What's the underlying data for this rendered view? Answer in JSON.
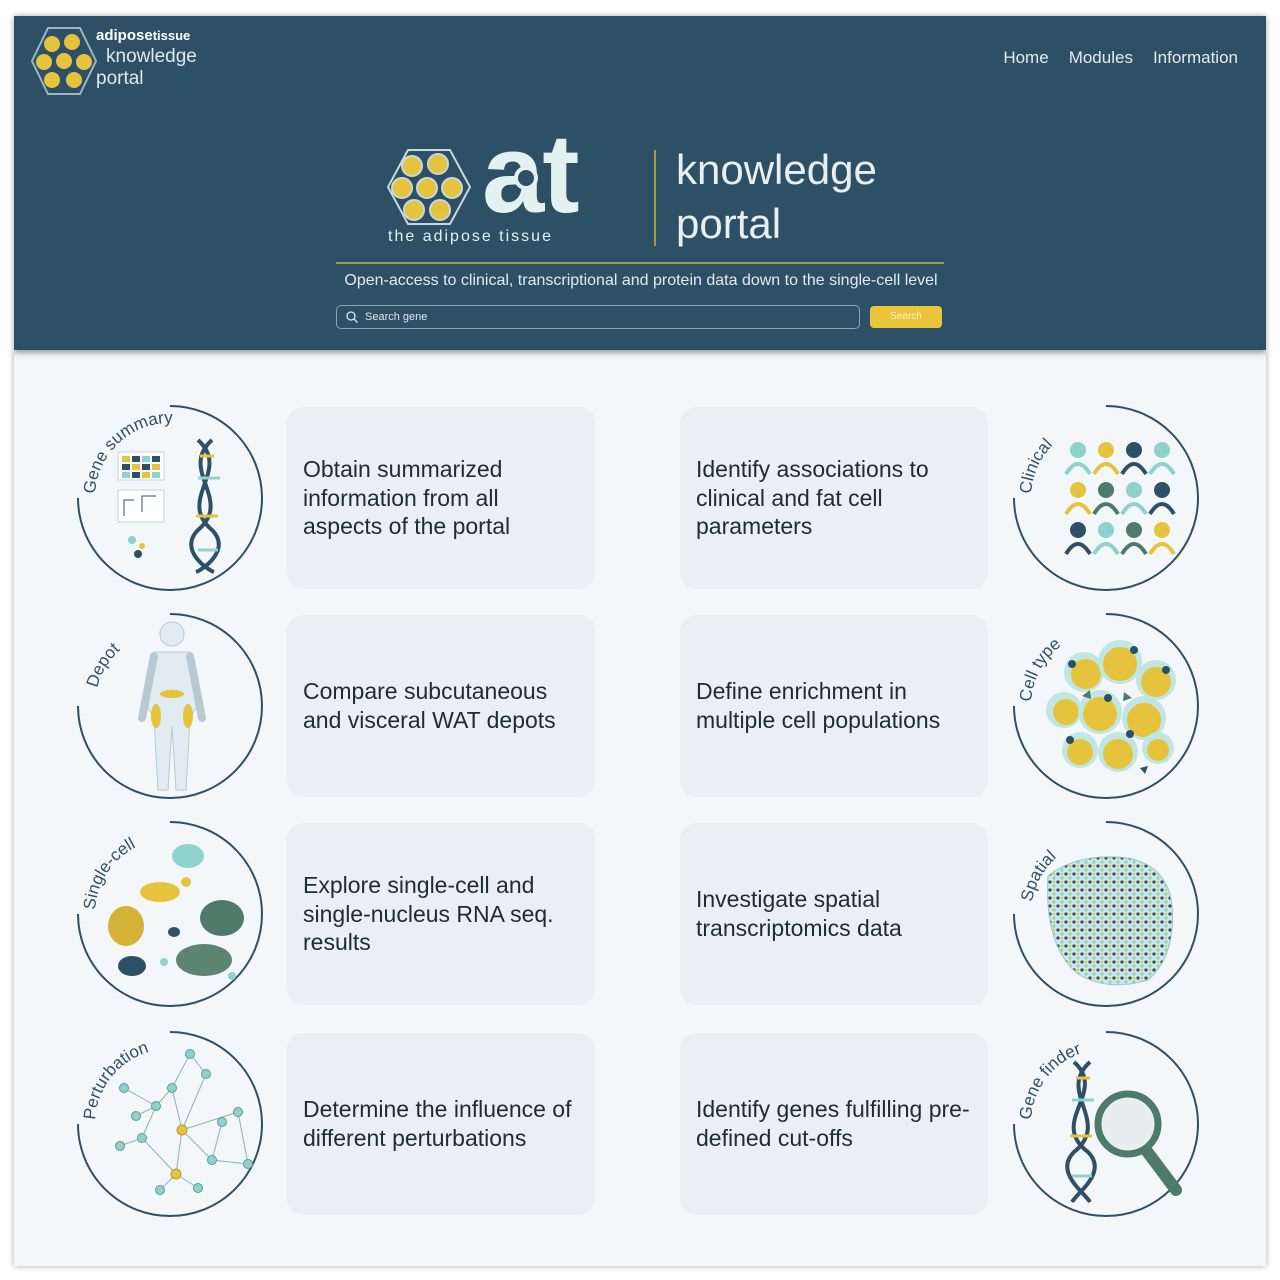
{
  "header": {
    "brand": {
      "line1": "adipose",
      "line1_sub": "tissue",
      "line2": "knowledge",
      "line3": "portal"
    },
    "nav": [
      "Home",
      "Modules",
      "Information"
    ],
    "hero": {
      "letters": "at",
      "tag": "the adipose tissue",
      "word1": "knowledge",
      "word2": "portal"
    },
    "tagline": "Open-access to clinical, transcriptional and protein data down to the single-cell level",
    "search": {
      "placeholder": "Search gene",
      "button": "Search"
    }
  },
  "modules": [
    {
      "label": "Gene summary",
      "description": "Obtain summarized information from all aspects of the portal",
      "icon": "dna-heatmap-icon"
    },
    {
      "label": "Clinical",
      "description": "Identify associations to clinical and fat cell parameters",
      "icon": "people-icon"
    },
    {
      "label": "Depot",
      "description": "Compare subcutaneous and  visceral WAT depots",
      "icon": "body-icon"
    },
    {
      "label": "Cell type",
      "description": "Define enrichment in multiple cell populations",
      "icon": "adipocytes-icon"
    },
    {
      "label": "Single-cell",
      "description": "Explore single-cell and single-nucleus RNA seq. results",
      "icon": "umap-icon"
    },
    {
      "label": "Spatial",
      "description": "Investigate spatial transcriptomics data",
      "icon": "spatial-map-icon"
    },
    {
      "label": "Perturbation",
      "description": "Determine the influence of different perturbations",
      "icon": "network-icon"
    },
    {
      "label": "Gene finder",
      "description": "Identify genes fulfilling pre-defined cut-offs",
      "icon": "dna-magnifier-icon"
    }
  ],
  "colors": {
    "navy": "#2e5066",
    "gold": "#eac53c",
    "teal": "#8fd1cc",
    "card": "#e9f0f3",
    "bg": "#f3f7fa"
  }
}
